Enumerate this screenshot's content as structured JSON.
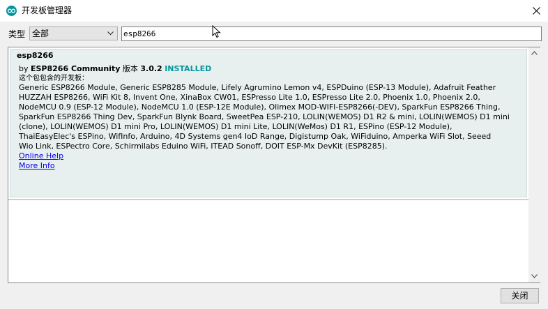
{
  "window": {
    "title": "开发板管理器"
  },
  "filter": {
    "type_label": "类型",
    "type_value": "全部",
    "search_value": "esp8266"
  },
  "package": {
    "name": "esp8266",
    "by_prefix": "by",
    "author": "ESP8266 Community",
    "version_label": "版本",
    "version": "3.0.2",
    "status": "INSTALLED",
    "boards_label": "这个包包含的开发板：",
    "boards_lines": [
      "Generic ESP8266 Module, Generic ESP8285 Module, Lifely Agrumino Lemon v4, ESPDuino (ESP-13 Module), Adafruit Feather",
      "HUZZAH ESP8266, WiFi Kit 8, Invent One, XinaBox CW01, ESPresso Lite 1.0, ESPresso Lite 2.0, Phoenix 1.0, Phoenix 2.0,",
      "NodeMCU 0.9 (ESP-12 Module), NodeMCU 1.0 (ESP-12E Module), Olimex MOD-WIFI-ESP8266(-DEV), SparkFun ESP8266 Thing,",
      "SparkFun ESP8266 Thing Dev, SparkFun Blynk Board, SweetPea ESP-210, LOLIN(WEMOS) D1 R2 & mini, LOLIN(WEMOS) D1 mini",
      "(clone), LOLIN(WEMOS) D1 mini Pro, LOLIN(WEMOS) D1 mini Lite, LOLIN(WeMos) D1 R1, ESPino (ESP-12 Module),",
      "ThaiEasyElec's ESPino, WifInfo, Arduino, 4D Systems gen4 IoD Range, Digistump Oak, WiFiduino, Amperka WiFi Slot, Seeed",
      "Wio Link, ESPectro Core, Schirmilabs Eduino WiFi, ITEAD Sonoff, DOIT ESP-Mx DevKit (ESP8285)."
    ],
    "online_help": "Online Help",
    "more_info": "More Info"
  },
  "footer": {
    "close_label": "关闭"
  },
  "colors": {
    "accent": "#00979c",
    "link": "#0000ee",
    "entry_bg": "#e8efef"
  },
  "icons": {
    "app": "arduino-logo-icon",
    "close": "close-icon",
    "dropdown": "chevron-down-icon",
    "cursor": "mouse-pointer-icon"
  }
}
